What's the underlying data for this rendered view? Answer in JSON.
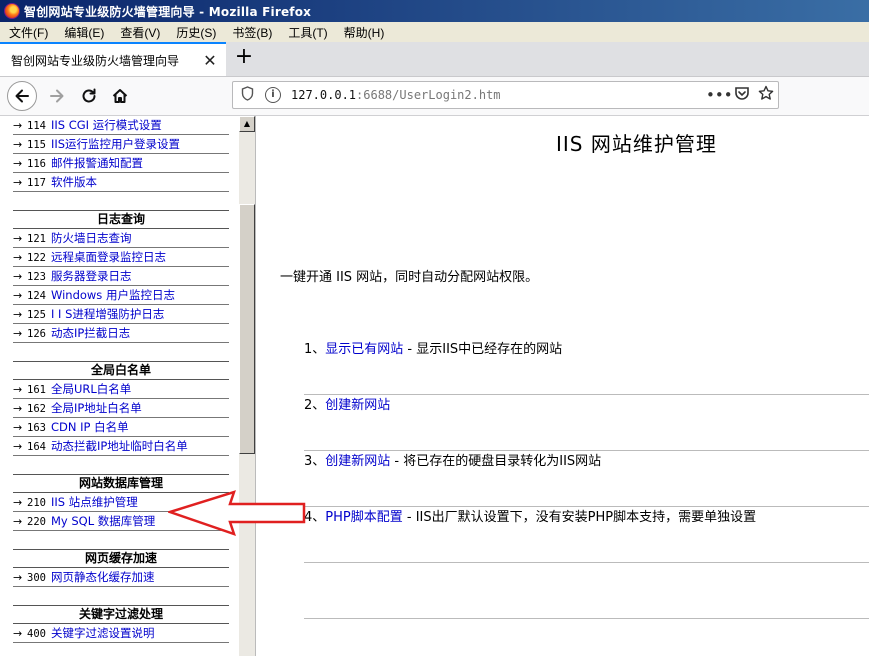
{
  "window": {
    "title": "智创网站专业级防火墙管理向导 - Mozilla Firefox"
  },
  "menubar": {
    "items": [
      "文件(F)",
      "编辑(E)",
      "查看(V)",
      "历史(S)",
      "书签(B)",
      "工具(T)",
      "帮助(H)"
    ]
  },
  "tabbar": {
    "tab_title": "智创网站专业级防火墙管理向导",
    "close_glyph": "✕",
    "new_tab_glyph": "+"
  },
  "nav": {
    "url_host": "127.0.0.1",
    "url_rest": ":6688/UserLogin2.htm",
    "more_glyph": "•••"
  },
  "sidebar": {
    "top_items": [
      {
        "num": "114",
        "label": "IIS CGI 运行模式设置"
      },
      {
        "num": "115",
        "label": "IIS运行监控用户登录设置"
      },
      {
        "num": "116",
        "label": "邮件报警通知配置"
      },
      {
        "num": "117",
        "label": "软件版本"
      }
    ],
    "sections": [
      {
        "heading": "日志查询",
        "items": [
          {
            "num": "121",
            "label": "防火墙日志查询"
          },
          {
            "num": "122",
            "label": "远程桌面登录监控日志"
          },
          {
            "num": "123",
            "label": "服务器登录日志"
          },
          {
            "num": "124",
            "label": "Windows 用户监控日志"
          },
          {
            "num": "125",
            "label": "I I S进程增强防护日志"
          },
          {
            "num": "126",
            "label": "动态IP拦截日志"
          }
        ]
      },
      {
        "heading": "全局白名单",
        "items": [
          {
            "num": "161",
            "label": "全局URL白名单"
          },
          {
            "num": "162",
            "label": "全局IP地址白名单"
          },
          {
            "num": "163",
            "label": "CDN IP 白名单"
          },
          {
            "num": "164",
            "label": "动态拦截IP地址临时白名单"
          }
        ]
      },
      {
        "heading": "网站数据库管理",
        "items": [
          {
            "num": "210",
            "label": "IIS 站点维护管理"
          },
          {
            "num": "220",
            "label": "My SQL 数据库管理"
          }
        ]
      },
      {
        "heading": "网页缓存加速",
        "items": [
          {
            "num": "300",
            "label": "网页静态化缓存加速"
          }
        ]
      },
      {
        "heading": "关键字过滤处理",
        "items": [
          {
            "num": "400",
            "label": "关键字过滤设置说明"
          }
        ]
      }
    ]
  },
  "main": {
    "title": "IIS 网站维护管理",
    "intro": "一键开通 IIS 网站，同时自动分配网站权限。",
    "rows": [
      {
        "prefix": "1、",
        "link": "显示已有网站",
        "desc": " - 显示IIS中已经存在的网站"
      },
      {
        "prefix": "2、",
        "link": "创建新网站",
        "desc": ""
      },
      {
        "prefix": "3、",
        "link": "创建新网站",
        "desc": " - 将已存在的硬盘目录转化为IIS网站"
      },
      {
        "prefix": "4、",
        "link": "PHP脚本配置",
        "desc": " - IIS出厂默认设置下，没有安装PHP脚本支持，需要单独设置"
      }
    ]
  },
  "colors": {
    "link": "#0000cc",
    "annotation_arrow": "#e02020"
  }
}
